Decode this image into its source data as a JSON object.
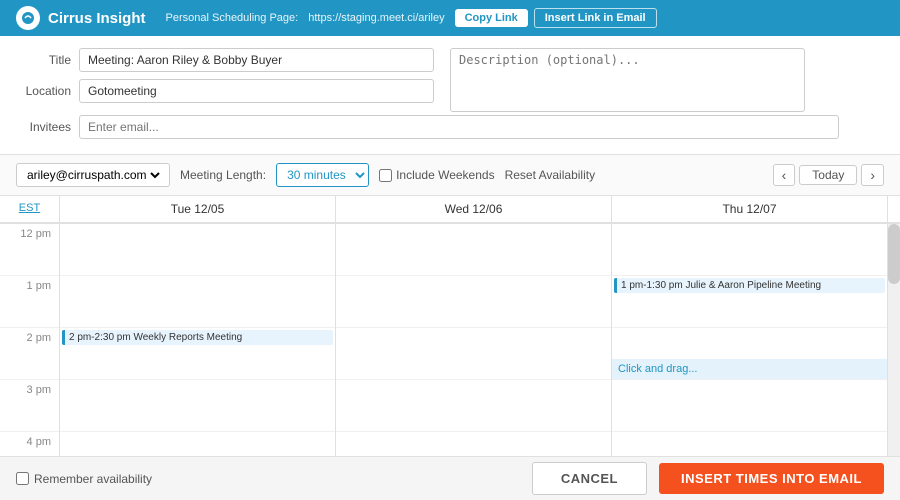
{
  "header": {
    "logo_text": "Cirrus Insight",
    "url_label": "Personal Scheduling Page:",
    "url_value": "https://staging.meet.ci/ariley",
    "copy_link_btn": "Copy Link",
    "insert_link_btn": "Insert Link in Email"
  },
  "form": {
    "title_label": "Title",
    "title_value": "Meeting: Aaron Riley & Bobby Buyer",
    "location_label": "Location",
    "location_value": "Gotomeeting",
    "invitees_label": "Invitees",
    "invitees_placeholder": "Enter email...",
    "description_placeholder": "Description (optional)..."
  },
  "toolbar": {
    "account": "ariley@cirruspath.com",
    "meeting_length_label": "Meeting Length:",
    "meeting_length_value": "30 minutes",
    "include_weekends_label": "Include Weekends",
    "reset_label": "Reset Availability",
    "today_btn": "Today"
  },
  "calendar": {
    "timezone": "EST",
    "days": [
      {
        "label": "Tue 12/05"
      },
      {
        "label": "Wed 12/06"
      },
      {
        "label": "Thu 12/07"
      }
    ],
    "time_slots": [
      {
        "label": "12 pm"
      },
      {
        "label": "1 pm"
      },
      {
        "label": "2 pm"
      },
      {
        "label": "3 pm"
      },
      {
        "label": "4 pm"
      }
    ],
    "events": [
      {
        "day_index": 2,
        "slot_index": 1,
        "text": "1 pm-1:30 pm   Julie & Aaron Pipeline Meeting",
        "top": 0,
        "height": 26
      },
      {
        "day_index": 0,
        "slot_index": 2,
        "text": "2 pm-2:30 pm   Weekly Reports Meeting",
        "top": 0,
        "height": 26
      },
      {
        "day_index": 2,
        "slot_index": 2,
        "is_drag": true,
        "text": "Click and drag..."
      }
    ]
  },
  "footer": {
    "remember_label": "Remember availability",
    "cancel_btn": "CANCEL",
    "insert_btn": "INSERT TIMES INTO EMAIL"
  }
}
